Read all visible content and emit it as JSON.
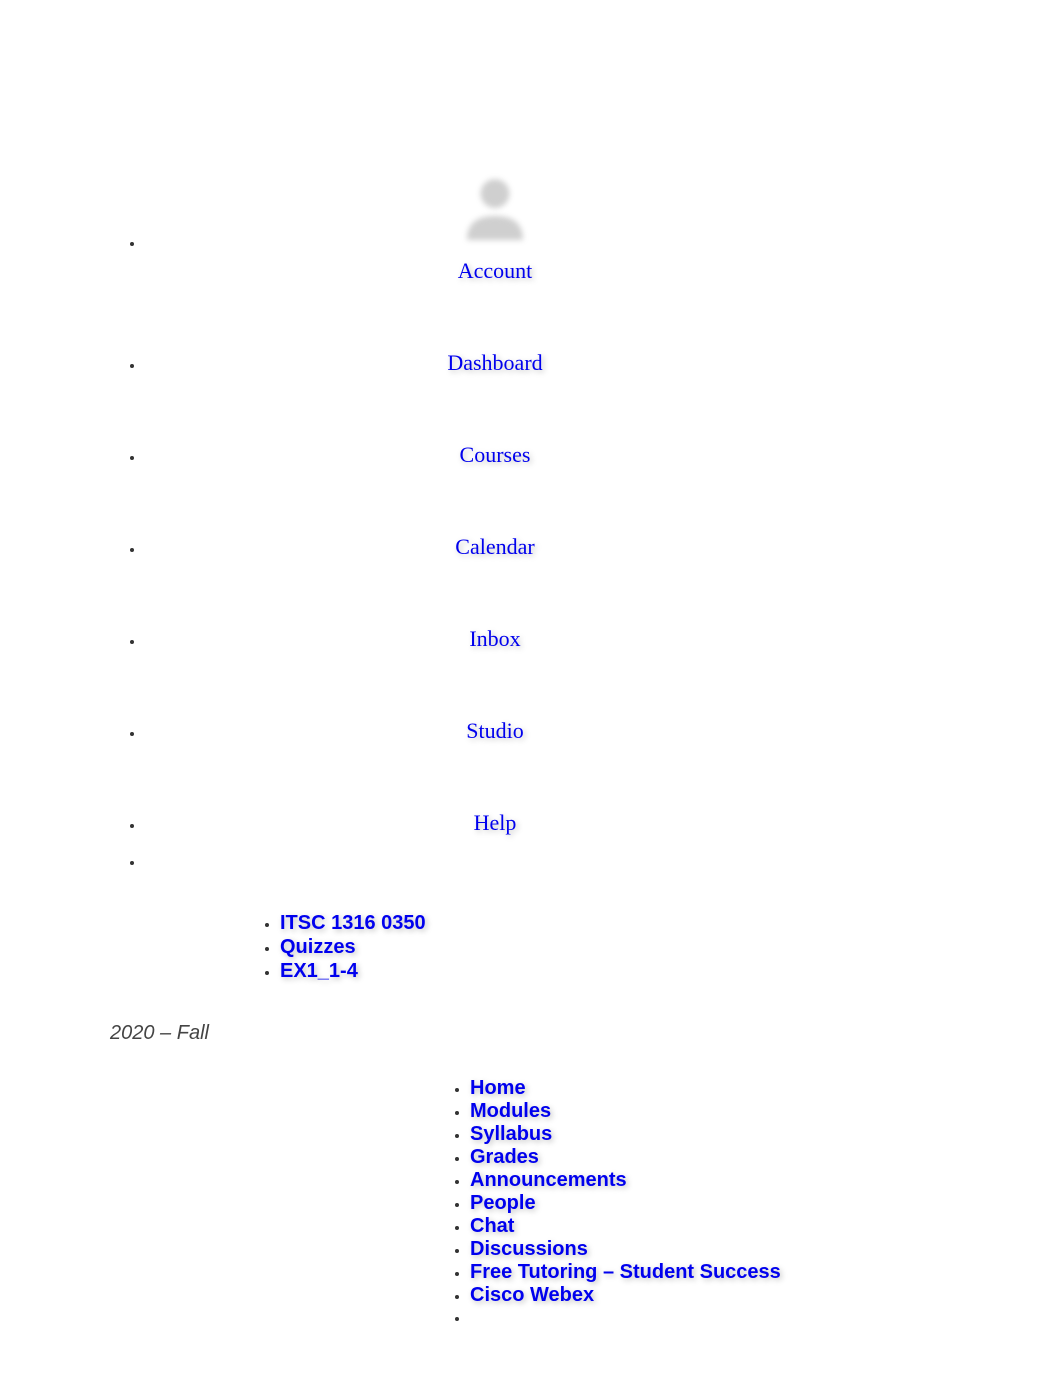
{
  "globalNav": {
    "account": "Account",
    "dashboard": "Dashboard",
    "courses": "Courses",
    "calendar": "Calendar",
    "inbox": "Inbox",
    "studio": "Studio",
    "help": "Help"
  },
  "breadcrumb": {
    "course": "ITSC 1316 0350",
    "section": "Quizzes",
    "item": "EX1_1-4"
  },
  "term": "2020 – Fall",
  "courseNav": {
    "home": "Home",
    "modules": "Modules",
    "syllabus": "Syllabus",
    "grades": "Grades",
    "announcements": "Announcements",
    "people": "People",
    "chat": "Chat",
    "discussions": "Discussions",
    "tutoring": "Free Tutoring – Student Success",
    "webex": "Cisco Webex"
  }
}
